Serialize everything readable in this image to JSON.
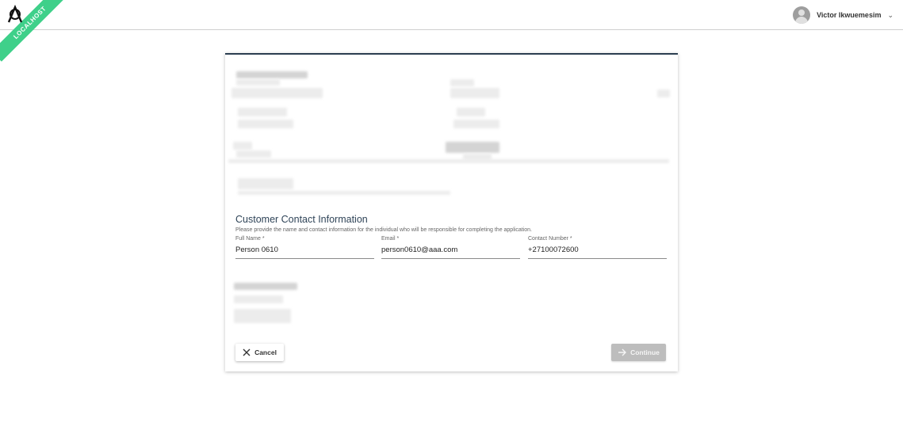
{
  "header": {
    "ribbon_text": "LOCALHOST",
    "user_name": "Victor Ikwuemesim"
  },
  "contact": {
    "title": "Customer Contact Information",
    "description": "Please provide the name and contact information for the individual who will be responsible for completing the application.",
    "fields": [
      {
        "label": "Full Name *",
        "value": "Person 0610"
      },
      {
        "label": "Email *",
        "value": "person0610@aaa.com"
      },
      {
        "label": "Contact Number *",
        "value": "+27100072600"
      }
    ]
  },
  "actions": {
    "cancel_label": "Cancel",
    "continue_label": "Continue"
  },
  "colors": {
    "accent": "#2b3e50",
    "ribbon": "#3fd08a",
    "disabled_button": "#bdbdbd"
  }
}
